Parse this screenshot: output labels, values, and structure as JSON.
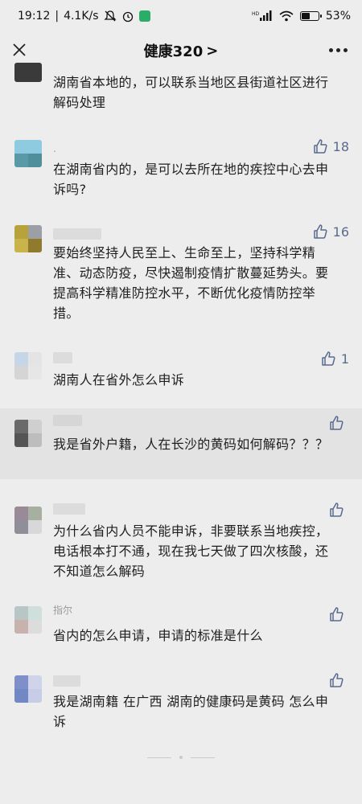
{
  "status_bar": {
    "time": "19:12",
    "net_speed": "4.1K/s",
    "battery": "53",
    "battery_fraction": 0.53,
    "icons": [
      "mute-icon",
      "alarm-icon",
      "wechat-badge-icon",
      "hd-icon",
      "signal-icon",
      "wifi-icon",
      "battery-icon"
    ]
  },
  "header": {
    "title": "健康320",
    "chevron": ">"
  },
  "comments": [
    {
      "nickname": "",
      "likes": "",
      "text": "湖南省本地的，可以联系当地区县街道社区进行解码处理"
    },
    {
      "nickname": ".",
      "likes": "18",
      "text": "在湖南省内的，是可以去所在地的疾控中心去申诉吗?"
    },
    {
      "nickname": "",
      "likes": "16",
      "text": "要始终坚持人民至上、生命至上，坚持科学精准、动态防疫，尽快遏制疫情扩散蔓延势头。要提高科学精准防控水平，不断优化疫情防控举措。"
    },
    {
      "nickname": "",
      "likes": "1",
      "text": "湖南人在省外怎么申诉"
    },
    {
      "nickname": "",
      "likes": "",
      "text": "我是省外户籍，人在长沙的黄码如何解码？？？"
    },
    {
      "nickname": "",
      "likes": "",
      "text": "为什么省内人员不能申诉，非要联系当地疾控，电话根本打不通，现在我七天做了四次核酸，还不知道怎么解码"
    },
    {
      "nickname": "指尔",
      "likes": "",
      "text": "省内的怎么申请，申请的标准是什么"
    },
    {
      "nickname": "",
      "likes": "",
      "text": "我是湖南籍  在广西  湖南的健康码是黄码 怎么申诉"
    }
  ],
  "colors": {
    "background": "#ededed",
    "highlight_row": "#e3e3e3",
    "like_blue": "#5a6b8f",
    "wechat_green": "#2aae67"
  }
}
